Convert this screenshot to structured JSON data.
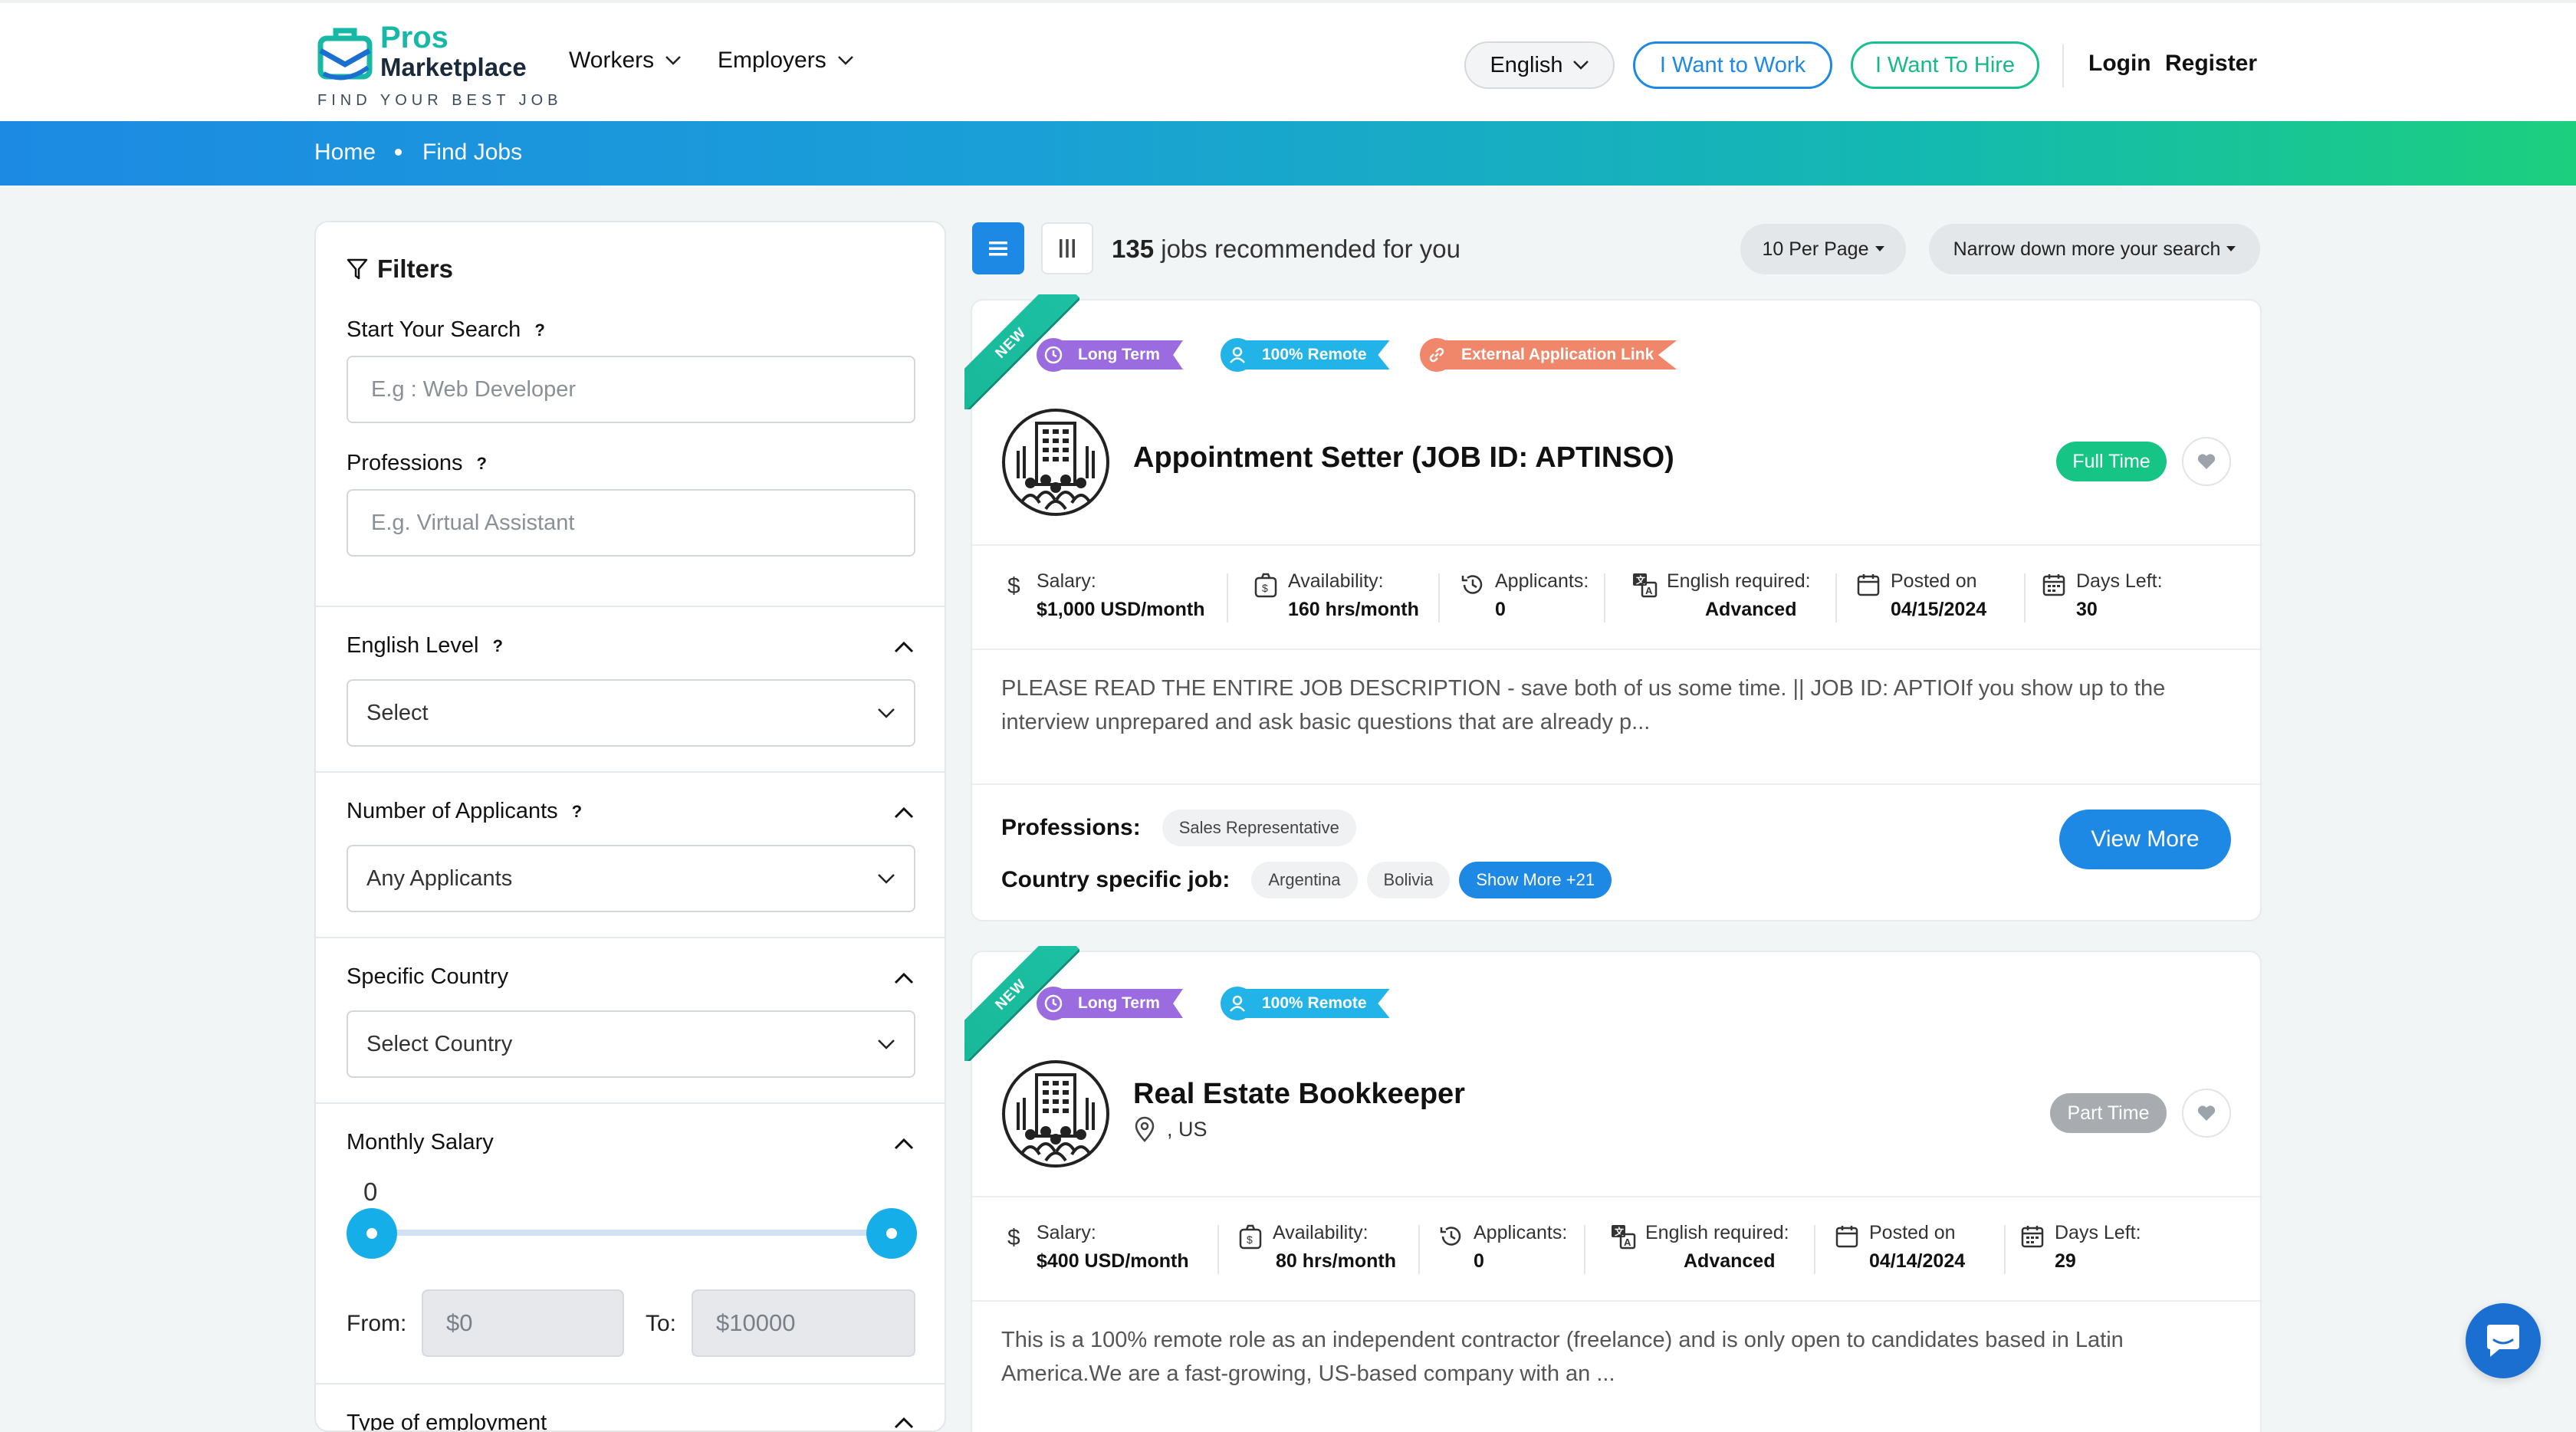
{
  "brand": {
    "name_line1": "Pros",
    "name_line2": "Marketplace",
    "tagline": "FIND YOUR BEST JOB",
    "accent": "#1e88e5",
    "green": "#18c08f"
  },
  "nav": {
    "workers": "Workers",
    "employers": "Employers",
    "language": "English",
    "want_work": "I Want to Work",
    "want_hire": "I Want To Hire",
    "login": "Login",
    "register": "Register"
  },
  "breadcrumb": {
    "home": "Home",
    "current": "Find Jobs"
  },
  "filters": {
    "title": "Filters",
    "start_search": {
      "label": "Start Your Search",
      "help": "?",
      "placeholder": "E.g : Web Developer"
    },
    "professions": {
      "label": "Professions",
      "help": "?",
      "placeholder": "E.g. Virtual Assistant"
    },
    "english_level": {
      "label": "English Level",
      "help": "?",
      "value": "Select"
    },
    "applicants": {
      "label": "Number of Applicants",
      "help": "?",
      "value": "Any Applicants"
    },
    "country": {
      "label": "Specific Country",
      "value": "Select Country"
    },
    "salary": {
      "label": "Monthly Salary",
      "slider_value": "0",
      "from_label": "From:",
      "from_value": "$0",
      "to_label": "To:",
      "to_value": "$10000"
    },
    "employment": {
      "label": "Type of employment"
    }
  },
  "toolbar": {
    "count": "135",
    "count_suffix": "jobs recommended for you",
    "per_page": "10 Per Page",
    "narrow": "Narrow down more your search"
  },
  "jobs": [
    {
      "ribbon": "NEW",
      "tags": [
        "Long Term",
        "100% Remote",
        "External Application Link"
      ],
      "title": "Appointment Setter (JOB ID: APTINSO)",
      "type": "Full Time",
      "stats": {
        "salary_label": "Salary:",
        "salary": "$1,000 USD/month",
        "availability_label": "Availability:",
        "availability": "160 hrs/month",
        "applicants_label": "Applicants:",
        "applicants": "0",
        "english_label": "English required:",
        "english": "Advanced",
        "posted_label": "Posted on",
        "posted": "04/15/2024",
        "days_label": "Days Left:",
        "days": "30"
      },
      "description": "PLEASE READ THE ENTIRE JOB DESCRIPTION - save both of us some time. || JOB ID: APTIOIf you show up to the interview unprepared and ask basic questions that are already p...",
      "professions_label": "Professions:",
      "professions": [
        "Sales Representative"
      ],
      "country_label": "Country specific job:",
      "countries": [
        "Argentina",
        "Bolivia"
      ],
      "show_more": "Show More +21",
      "view_more": "View More"
    },
    {
      "ribbon": "NEW",
      "tags": [
        "Long Term",
        "100% Remote"
      ],
      "title": "Real Estate Bookkeeper",
      "location": ", US",
      "type": "Part Time",
      "stats": {
        "salary_label": "Salary:",
        "salary": "$400 USD/month",
        "availability_label": "Availability:",
        "availability": "80 hrs/month",
        "applicants_label": "Applicants:",
        "applicants": "0",
        "english_label": "English required:",
        "english": "Advanced",
        "posted_label": "Posted on",
        "posted": "04/14/2024",
        "days_label": "Days Left:",
        "days": "29"
      },
      "description": "This is a 100% remote role as an independent contractor (freelance) and is only open to candidates based in Latin America.We are a fast-growing, US-based company with an ..."
    }
  ]
}
